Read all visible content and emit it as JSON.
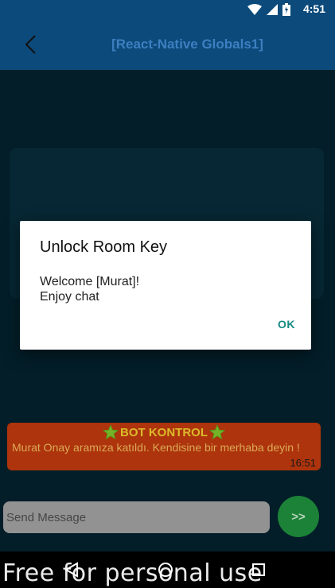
{
  "status_bar": {
    "time": "4:51",
    "icons": [
      "wifi-icon",
      "signal-icon",
      "battery-icon"
    ]
  },
  "app_bar": {
    "title": "[React-Native Globals1]"
  },
  "dialog": {
    "title": "Unlock Room Key",
    "message_line1": "Welcome [Murat]!",
    "message_line2": "Enjoy chat",
    "ok_label": "OK"
  },
  "bot_message": {
    "title": "BOT KONTROL",
    "text": "Murat Onay aramıza katıldı. Kendisine bir merhaba deyin !",
    "time": "16:51"
  },
  "composer": {
    "placeholder": "Send Message",
    "send_label": ">>"
  },
  "watermark": "Free for personal use",
  "colors": {
    "app_bar": "#0c4a7b",
    "background": "#04202c",
    "bot_bubble": "#b7370d",
    "send_button": "#1e8a3a",
    "accent": "#138a82"
  }
}
